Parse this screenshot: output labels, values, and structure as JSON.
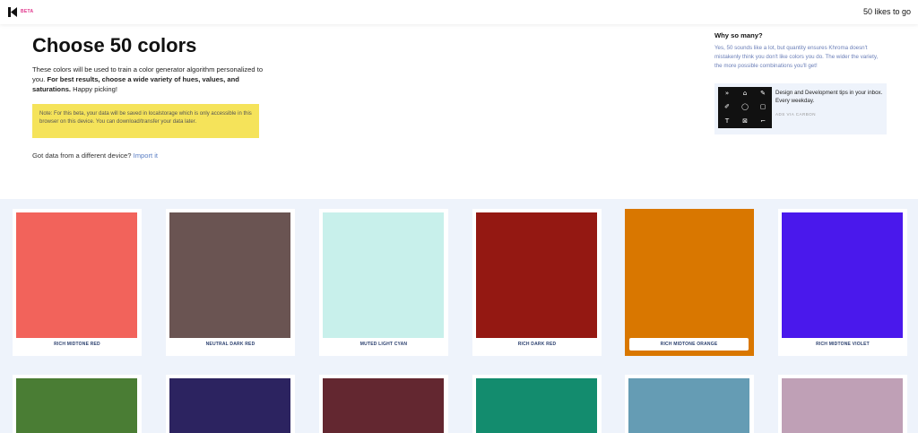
{
  "header": {
    "beta_label": "BETA",
    "likes_to_go": "50 likes to go"
  },
  "intro": {
    "title": "Choose 50 colors",
    "description_plain": "These colors will be used to train a color generator algorithm personalized to you. ",
    "description_bold": "For best results, choose a wide variety of hues, values, and saturations.",
    "description_tail": " Happy picking!",
    "note": "Note: For this beta, your data will be saved in localstorage which is only accessible in this browser on this device. You can download/transfer your data later.",
    "import_prompt": "Got data from a different device?",
    "import_link": "Import it"
  },
  "sidebar": {
    "why_title": "Why so many?",
    "why_text": "Yes, 50 sounds like a lot, but quantity ensures Khroma doesn't mistakenly think you don't like colors you do. The wider the variety, the more possible combinations you'll get!",
    "ad_text": "Design and Development tips in your inbox. Every weekday.",
    "ad_via": "ADS VIA CARBON",
    "ad_icons": [
      "»",
      "⌂",
      "✎",
      "✐",
      "◯",
      "▢",
      "T",
      "⊠",
      "⌐"
    ]
  },
  "colors_row1": [
    {
      "label": "RICH MIDTONE RED",
      "hex": "#f2635b"
    },
    {
      "label": "NEUTRAL DARK RED",
      "hex": "#6a5452"
    },
    {
      "label": "MUTED LIGHT CYAN",
      "hex": "#c8f0eb"
    },
    {
      "label": "RICH DARK RED",
      "hex": "#941812"
    },
    {
      "label": "RICH MIDTONE ORANGE",
      "hex": "#d97700",
      "selected": true
    },
    {
      "label": "RICH MIDTONE VIOLET",
      "hex": "#4a18ec"
    }
  ],
  "colors_row2": [
    {
      "hex": "#4a7d34"
    },
    {
      "hex": "#2c2360"
    },
    {
      "hex": "#632730"
    },
    {
      "hex": "#138c6e"
    },
    {
      "hex": "#659cb4"
    },
    {
      "hex": "#bfa0b6"
    }
  ]
}
